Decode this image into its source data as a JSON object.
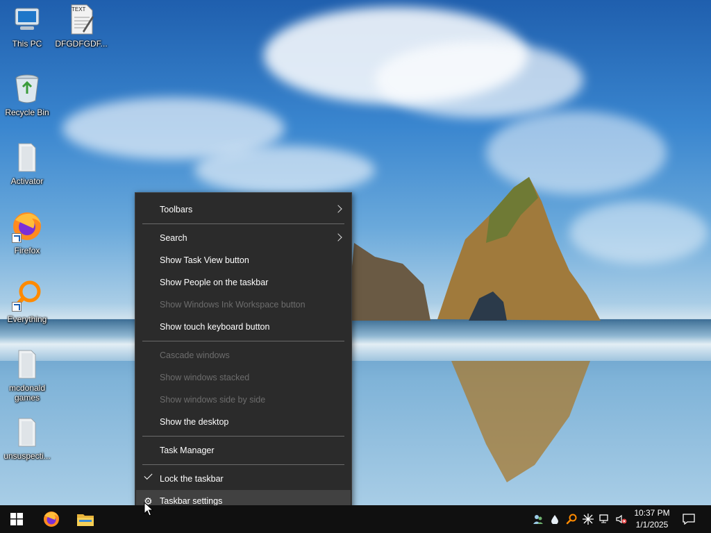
{
  "desktop": {
    "icons": [
      {
        "label": "This PC",
        "icon": "this-pc-icon"
      },
      {
        "label": "DFGDFGDF...",
        "icon": "text-file-icon",
        "badge": "TEXT"
      },
      {
        "label": "Recycle Bin",
        "icon": "recycle-bin-icon"
      },
      {
        "label": "Activator",
        "icon": "folder-icon"
      },
      {
        "label": "Firefox",
        "icon": "firefox-icon"
      },
      {
        "label": "Everything",
        "icon": "everything-search-icon"
      },
      {
        "label": "mcdonald games",
        "icon": "folder-icon"
      },
      {
        "label": "unsuspecti...",
        "icon": "folder-icon"
      }
    ]
  },
  "context_menu": {
    "items": [
      {
        "label": "Toolbars",
        "enabled": true,
        "submenu": true
      },
      {
        "label": "Search",
        "enabled": true,
        "submenu": true
      },
      {
        "label": "Show Task View button",
        "enabled": true
      },
      {
        "label": "Show People on the taskbar",
        "enabled": true
      },
      {
        "label": "Show Windows Ink Workspace button",
        "enabled": false
      },
      {
        "label": "Show touch keyboard button",
        "enabled": true
      },
      {
        "label": "Cascade windows",
        "enabled": false
      },
      {
        "label": "Show windows stacked",
        "enabled": false
      },
      {
        "label": "Show windows side by side",
        "enabled": false
      },
      {
        "label": "Show the desktop",
        "enabled": true
      },
      {
        "label": "Task Manager",
        "enabled": true
      },
      {
        "label": "Lock the taskbar",
        "enabled": true,
        "checked": true
      },
      {
        "label": "Taskbar settings",
        "enabled": true,
        "icon": "gear-icon",
        "highlighted": true
      }
    ]
  },
  "taskbar": {
    "pinned": [
      "start-icon",
      "firefox-icon",
      "file-explorer-icon"
    ],
    "tray": [
      "people-icon",
      "dropbox-icon",
      "everything-search-icon",
      "crosshair-icon",
      "network-icon",
      "volume-muted-icon"
    ],
    "clock": {
      "time": "10:37 PM",
      "date": "1/1/2025"
    },
    "notification_icon": "action-center-icon"
  },
  "colors": {
    "menu_bg": "#2b2b2b",
    "menu_hover": "#414141",
    "menu_disabled_text": "#6d6d6d",
    "taskbar_bg": "#101010",
    "start_blue": "#ffffff"
  }
}
